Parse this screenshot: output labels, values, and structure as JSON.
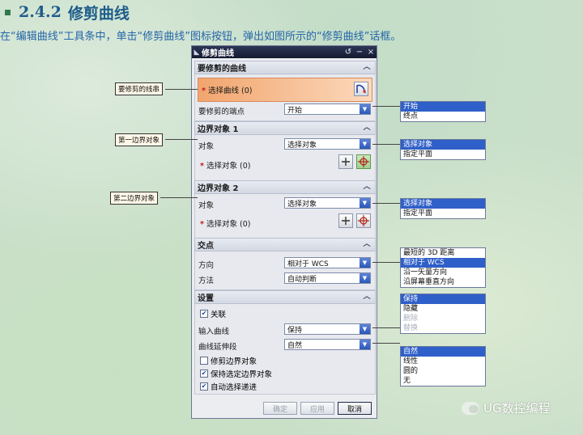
{
  "heading": {
    "number": "2.4.2",
    "title": "修剪曲线"
  },
  "intro": "在“编辑曲线”工具条中，单击“修剪曲线”图标按钮，弹出如图所示的“修剪曲线”话框。",
  "dialog": {
    "title": "修剪曲线",
    "title_buttons": [
      "↺",
      "−",
      "×"
    ],
    "curve_section": {
      "header": "要修剪的曲线",
      "select_label": "选择曲线 (0)",
      "end_label": "要修剪的端点",
      "end_value": "开始"
    },
    "boundary1": {
      "header": "边界对象 1",
      "object_label": "对象",
      "object_value": "选择对象",
      "select_label": "选择对象 (0)"
    },
    "boundary2": {
      "header": "边界对象 2",
      "object_label": "对象",
      "object_value": "选择对象",
      "select_label": "选择对象 (0)"
    },
    "intersection": {
      "header": "交点",
      "direction_label": "方向",
      "direction_value": "相对于 WCS",
      "method_label": "方法",
      "method_value": "自动判断"
    },
    "settings": {
      "header": "设置",
      "associative_label": "关联",
      "associative_checked": true,
      "input_curve_label": "输入曲线",
      "input_curve_value": "保持",
      "extension_label": "曲线延伸段",
      "extension_value": "自然",
      "trim_boundary_label": "修剪边界对象",
      "trim_boundary_checked": false,
      "keep_boundary_label": "保持选定边界对象",
      "keep_boundary_checked": true,
      "auto_select_label": "自动选择递进",
      "auto_select_checked": true
    },
    "buttons": {
      "ok": "确定",
      "apply": "应用",
      "cancel": "取消"
    }
  },
  "callouts": {
    "curve": "要修剪的线串",
    "boundary1": "第一边界对象",
    "boundary2": "第二边界对象"
  },
  "dropdowns": {
    "end": [
      "开始",
      "终点"
    ],
    "boundary1": [
      "选择对象",
      "指定平面"
    ],
    "boundary2": [
      "选择对象",
      "指定平面"
    ],
    "direction": [
      "最短的 3D 距离",
      "相对于 WCS",
      "沿一矢量方向",
      "沿屏幕垂直方向"
    ],
    "input_curve": [
      "保持",
      "隐藏",
      "删除",
      "替换"
    ],
    "extension": [
      "自然",
      "线性",
      "圆的",
      "无"
    ]
  },
  "watermark": "UG数控编程",
  "colors": {
    "selected_item": "#2f5fc8",
    "title_bar": "#141a30",
    "heading": "#1d5c8a"
  }
}
